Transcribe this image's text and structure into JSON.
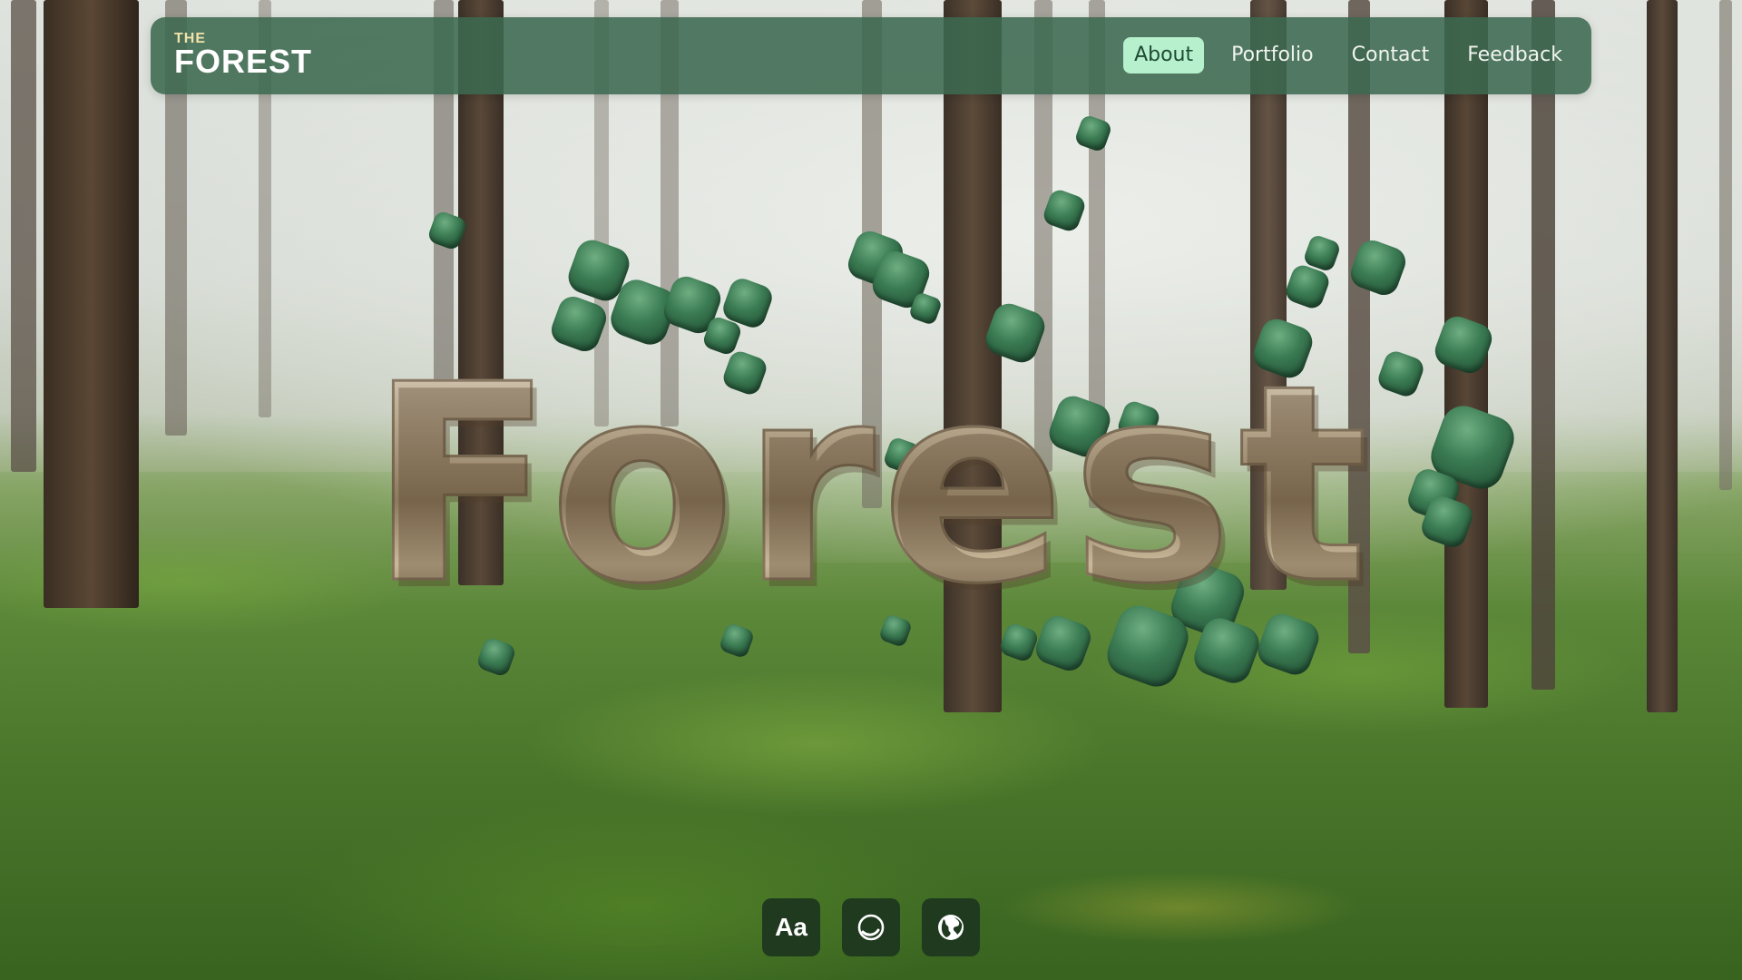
{
  "logo": {
    "small": "THE",
    "big": "FOREST"
  },
  "nav": {
    "items": [
      {
        "label": "About",
        "active": true
      },
      {
        "label": "Portfolio",
        "active": false
      },
      {
        "label": "Contact",
        "active": false
      },
      {
        "label": "Feedback",
        "active": false
      }
    ]
  },
  "hero": {
    "title": "Forest"
  },
  "toolbar": {
    "font_button_label": "Aa",
    "icons": [
      "font-icon",
      "circle-loader-icon",
      "globe-icon"
    ]
  },
  "colors": {
    "nav_bg": "#3c6950",
    "nav_active_bg": "#b6f0cc",
    "tool_bg": "#1f3a1e"
  }
}
